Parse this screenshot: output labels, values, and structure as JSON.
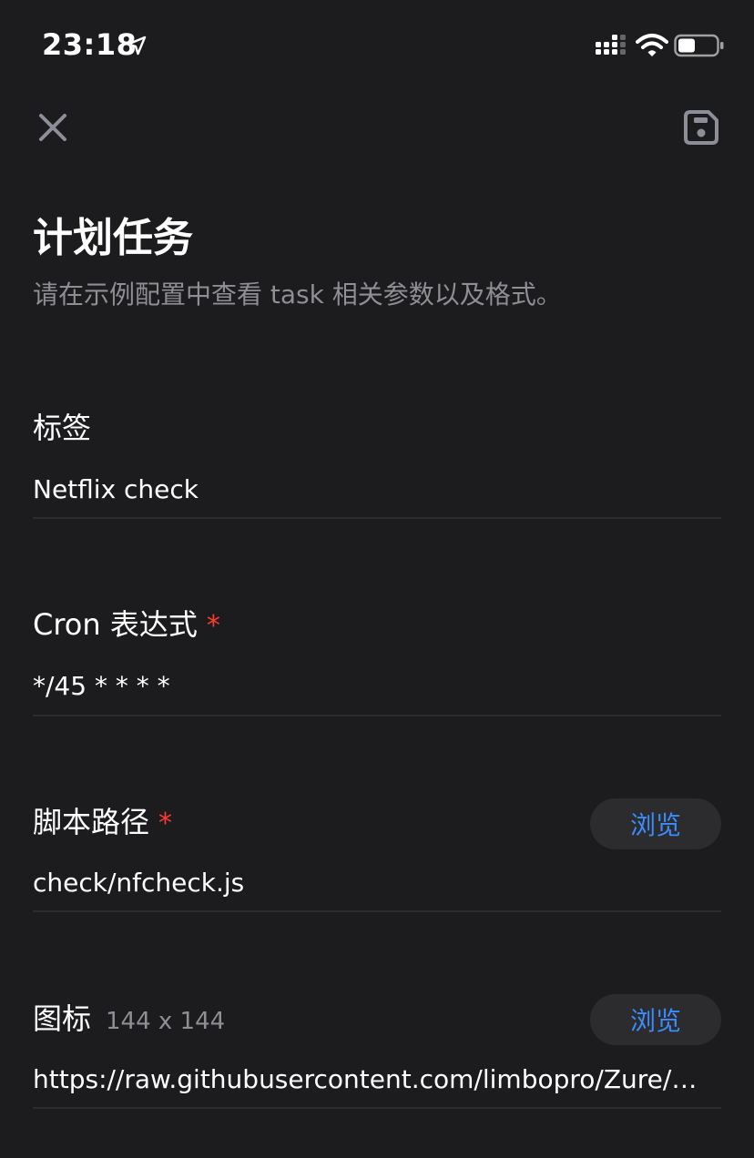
{
  "status_bar": {
    "time": "23:18",
    "battery_level": 0.45
  },
  "nav": {
    "close_icon": "close-icon",
    "save_icon": "save-icon"
  },
  "header": {
    "title": "计划任务",
    "subtitle": "请在示例配置中查看 task 相关参数以及格式。"
  },
  "fields": {
    "tag": {
      "label": "标签",
      "value": "Netflix check"
    },
    "cron": {
      "label": "Cron 表达式",
      "required_mark": "*",
      "value": "*/45 * * * *"
    },
    "script_path": {
      "label": "脚本路径",
      "required_mark": "*",
      "value": "check/nfcheck.js",
      "browse_label": "浏览"
    },
    "icon": {
      "label": "图标",
      "hint": "144 x 144",
      "value": "https://raw.githubusercontent.com/limbopro/Zure/ma…",
      "browse_label": "浏览"
    }
  },
  "colors": {
    "background": "#1c1c1e",
    "accent": "#3a8cff",
    "required": "#ff3b30",
    "secondary_text": "#8e8e93",
    "divider": "#2c2c2e"
  }
}
